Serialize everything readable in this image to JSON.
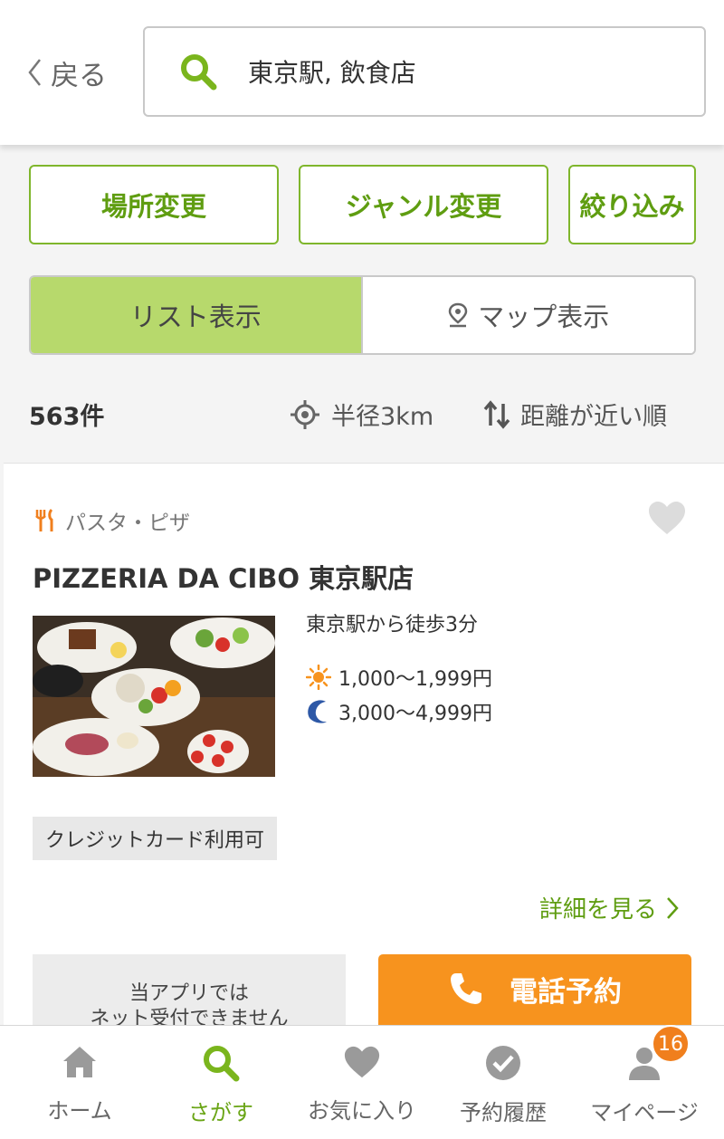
{
  "header": {
    "back_label": "戻る",
    "search_query": "東京駅, 飲食店"
  },
  "filters": {
    "location_label": "場所変更",
    "genre_label": "ジャンル変更",
    "narrow_label": "絞り込み"
  },
  "view_toggle": {
    "list_label": "リスト表示",
    "map_label": "マップ表示",
    "selected": "list"
  },
  "results": {
    "count": "563件",
    "radius": "半径3km",
    "sort": "距離が近い順"
  },
  "restaurant": {
    "genre": "パスタ・ピザ",
    "name": "PIZZERIA DA CIBO 東京駅店",
    "access": "東京駅から徒歩3分",
    "lunch_price": "1,000〜1,999円",
    "dinner_price": "3,000〜4,999円",
    "tag": "クレジットカード利用可",
    "detail_link": "詳細を見る",
    "no_web_line1": "当アプリでは",
    "no_web_line2": "ネット受付できません",
    "phone_label": "電話予約"
  },
  "tabbar": {
    "items": [
      {
        "label": "ホーム",
        "icon": "home-icon"
      },
      {
        "label": "さがす",
        "icon": "search-icon"
      },
      {
        "label": "お気に入り",
        "icon": "heart-icon"
      },
      {
        "label": "予約履歴",
        "icon": "check-circle-icon"
      },
      {
        "label": "マイページ",
        "icon": "person-icon"
      }
    ],
    "active_index": 1,
    "badge": "16"
  },
  "colors": {
    "accent_green": "#6aa516",
    "active_toggle": "#b7d96c",
    "phone_orange": "#f7931e",
    "badge_orange": "#f07f1d"
  }
}
